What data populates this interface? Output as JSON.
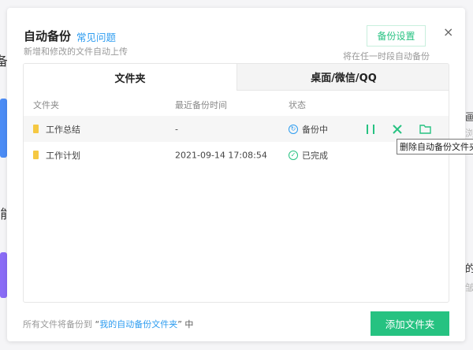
{
  "background_fragments": {
    "left": [
      "备",
      "]能"
    ],
    "right": [
      "画",
      "浏",
      "的",
      "皱"
    ]
  },
  "dialog": {
    "title": "自动备份",
    "faq_link": "常见问题",
    "subtitle": "新增和修改的文件自动上传",
    "settings_button": "备份设置",
    "settings_hint": "将在任一时段自动备份",
    "close_icon": "×"
  },
  "tabs": [
    {
      "label": "文件夹",
      "active": true
    },
    {
      "label": "桌面/微信/QQ",
      "active": false
    }
  ],
  "table": {
    "columns": [
      "文件夹",
      "最近备份时间",
      "状态"
    ],
    "rows": [
      {
        "name": "工作总结",
        "time": "-",
        "status": "备份中",
        "status_icon": "sync-icon",
        "status_color": "#2d9cf0",
        "actions": [
          "pause-icon",
          "delete-icon",
          "open-folder-icon"
        ]
      },
      {
        "name": "工作计划",
        "time": "2021-09-14 17:08:54",
        "status": "已完成",
        "status_icon": "check-circle-icon",
        "status_color": "#26c281"
      }
    ]
  },
  "tooltip": "删除自动备份文件夹",
  "footer": {
    "prefix": "所有文件将备份到",
    "open_quote": "“",
    "link": "我的自动备份文件夹",
    "close_quote": "”",
    "suffix": " 中",
    "add_button": "添加文件夹"
  },
  "colors": {
    "accent": "#26c281",
    "link": "#2d9cf0"
  }
}
